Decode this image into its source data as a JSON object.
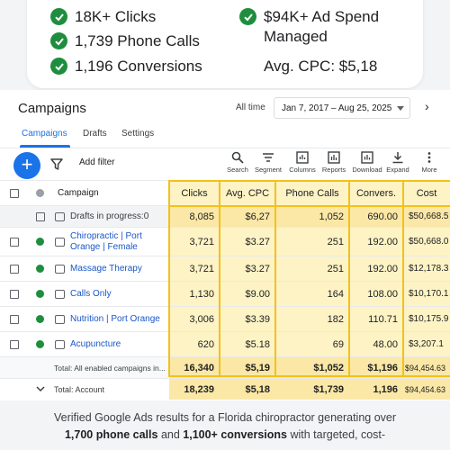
{
  "stats": {
    "left": [
      "18K+ Clicks",
      "1,739 Phone Calls",
      "1,196 Conversions"
    ],
    "right_line1": "$94K+ Ad Spend",
    "right_line2": "Managed",
    "avg_cpc": "Avg. CPC: $5,18"
  },
  "header": {
    "title": "Campaigns",
    "all_time": "All time",
    "date_range": "Jan 7, 2017 – Aug 25, 2025",
    "next": "›"
  },
  "tabs": [
    "Campaigns",
    "Drafts",
    "Settings"
  ],
  "toolbar": {
    "add": "+",
    "add_filter": "Add filter",
    "tools": [
      "Search",
      "Segment",
      "Columns",
      "Reports",
      "Download",
      "Expand",
      "More"
    ]
  },
  "table": {
    "columns": [
      "Campaign",
      "Clicks",
      "Avg. CPC",
      "Phone Calls",
      "Convers.",
      "Cost"
    ],
    "drafts_row": {
      "label": "Drafts in progress:0",
      "values": [
        "8,085",
        "$6,27",
        "1,052",
        "690.00",
        "$50,668.5"
      ]
    },
    "rows": [
      {
        "name": "Chiropractic | Port Orange | Female",
        "values": [
          "3,721",
          "$3.27",
          "251",
          "192.00",
          "$50,668.0"
        ]
      },
      {
        "name": "Massage Therapy",
        "values": [
          "3,721",
          "$3.27",
          "251",
          "192.00",
          "$12,178.3"
        ]
      },
      {
        "name": "Calls Only",
        "values": [
          "1,130",
          "$9.00",
          "164",
          "108.00",
          "$10,170.1"
        ]
      },
      {
        "name": "Nutrition | Port Orange",
        "values": [
          "3,006",
          "$3.39",
          "182",
          "110.71",
          "$10,175.9"
        ]
      },
      {
        "name": "Acupuncture",
        "values": [
          "620",
          "$5.18",
          "69",
          "48.00",
          "$3,207.1"
        ]
      }
    ],
    "total_enabled": {
      "label": "Total: All enabled campaigns in...",
      "values": [
        "16,340",
        "$5,19",
        "$1,052",
        "$1,196",
        "$94,454.63"
      ]
    },
    "total_account": {
      "label": "Total: Account",
      "values": [
        "18,239",
        "$5,18",
        "$1,739",
        "1,196",
        "$94,454.63"
      ]
    }
  },
  "caption": {
    "line1": "Verified Google Ads results for a Florida chiropractor generating over",
    "line2_bold1": "1,700 phone calls",
    "line2_mid": " and ",
    "line2_bold2": "1,100+ conversions",
    "line2_end": " with targeted, cost-"
  },
  "colors": {
    "accent": "#1a73e8",
    "check_green": "#1e8e3e",
    "highlight": "#fdf3c4",
    "highlight_border": "#f2c11b"
  }
}
